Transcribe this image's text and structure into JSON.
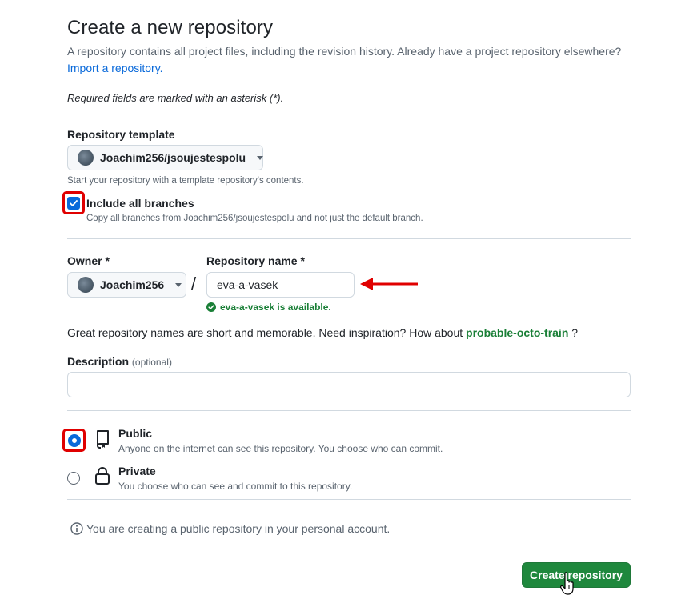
{
  "header": {
    "title": "Create a new repository",
    "intro": "A repository contains all project files, including the revision history. Already have a project repository elsewhere?",
    "import_link": "Import a repository."
  },
  "required_note": "Required fields are marked with an asterisk (*).",
  "template": {
    "label": "Repository template",
    "selected": "Joachim256/jsoujestespolu",
    "help": "Start your repository with a template repository's contents.",
    "include_branches_label": "Include all branches",
    "include_branches_help": "Copy all branches from Joachim256/jsoujestespolu and not just the default branch.",
    "include_branches_checked": true
  },
  "owner": {
    "label": "Owner *",
    "selected": "Joachim256"
  },
  "separator": "/",
  "repo_name": {
    "label": "Repository name *",
    "value": "eva-a-vasek",
    "availability": "eva-a-vasek is available."
  },
  "suggestion": {
    "text": "Great repository names are short and memorable. Need inspiration? How about",
    "name": "probable-octo-train",
    "suffix": "?"
  },
  "description": {
    "label": "Description",
    "optional": "(optional)",
    "value": "",
    "placeholder": ""
  },
  "visibility": {
    "selected": "public",
    "options": [
      {
        "title": "Public",
        "desc": "Anyone on the internet can see this repository. You choose who can commit.",
        "icon": "repo-icon"
      },
      {
        "title": "Private",
        "desc": "You choose who can see and commit to this repository.",
        "icon": "lock-icon"
      }
    ]
  },
  "info_note": "You are creating a public repository in your personal account.",
  "submit_label": "Create repository",
  "colors": {
    "accent": "#0969da",
    "success": "#1a7f37",
    "button": "#1f883d",
    "annotation": "#e00000"
  }
}
